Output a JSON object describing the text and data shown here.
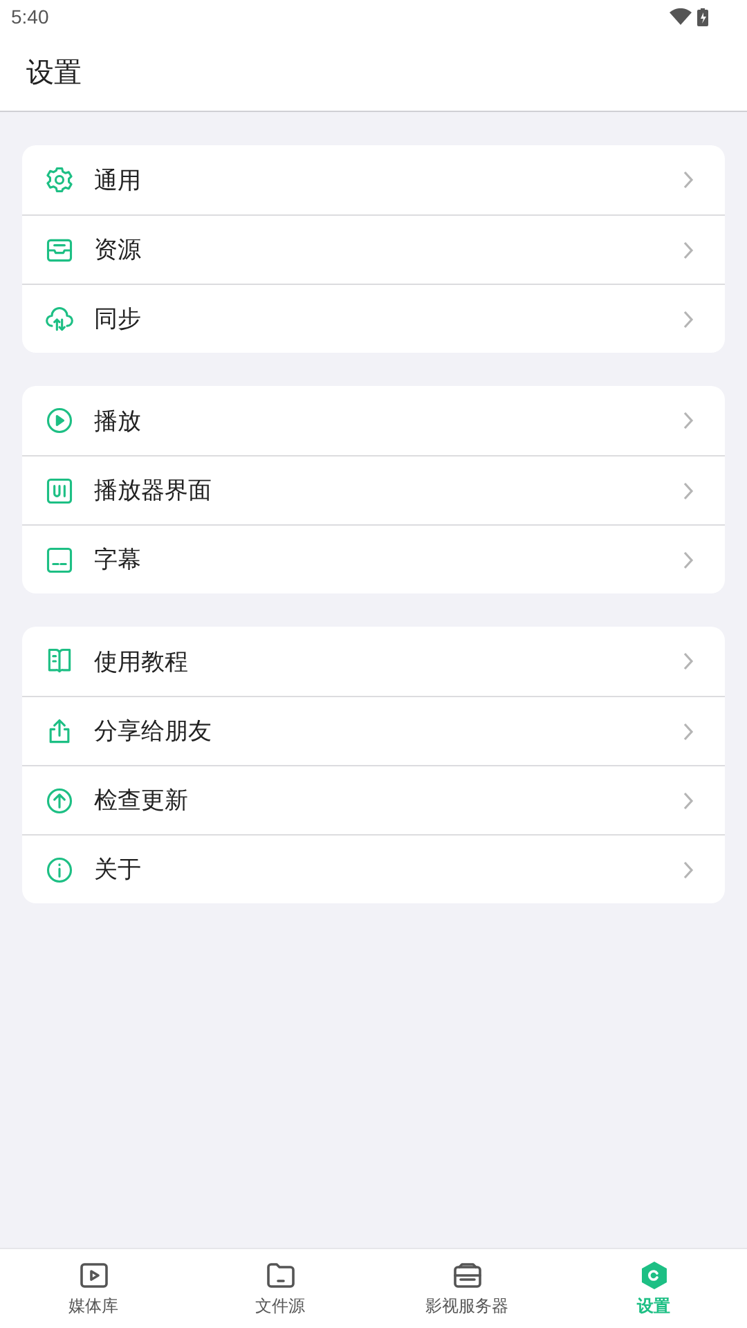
{
  "status_bar": {
    "time": "5:40"
  },
  "header": {
    "title": "设置"
  },
  "groups": [
    {
      "items": [
        {
          "kind": "gear",
          "label": "通用"
        },
        {
          "kind": "inbox",
          "label": "资源"
        },
        {
          "kind": "cloud",
          "label": "同步"
        }
      ]
    },
    {
      "items": [
        {
          "kind": "play",
          "label": "播放"
        },
        {
          "kind": "ui",
          "label": "播放器界面"
        },
        {
          "kind": "subtitle",
          "label": "字幕"
        }
      ]
    },
    {
      "items": [
        {
          "kind": "book",
          "label": "使用教程"
        },
        {
          "kind": "share",
          "label": "分享给朋友"
        },
        {
          "kind": "update",
          "label": "检查更新"
        },
        {
          "kind": "info",
          "label": "关于"
        }
      ]
    }
  ],
  "bottom_nav": [
    {
      "kind": "media",
      "label": "媒体库",
      "selected": false
    },
    {
      "kind": "folder",
      "label": "文件源",
      "selected": false
    },
    {
      "kind": "server",
      "label": "影视服务器",
      "selected": false
    },
    {
      "kind": "settings",
      "label": "设置",
      "selected": true
    }
  ]
}
